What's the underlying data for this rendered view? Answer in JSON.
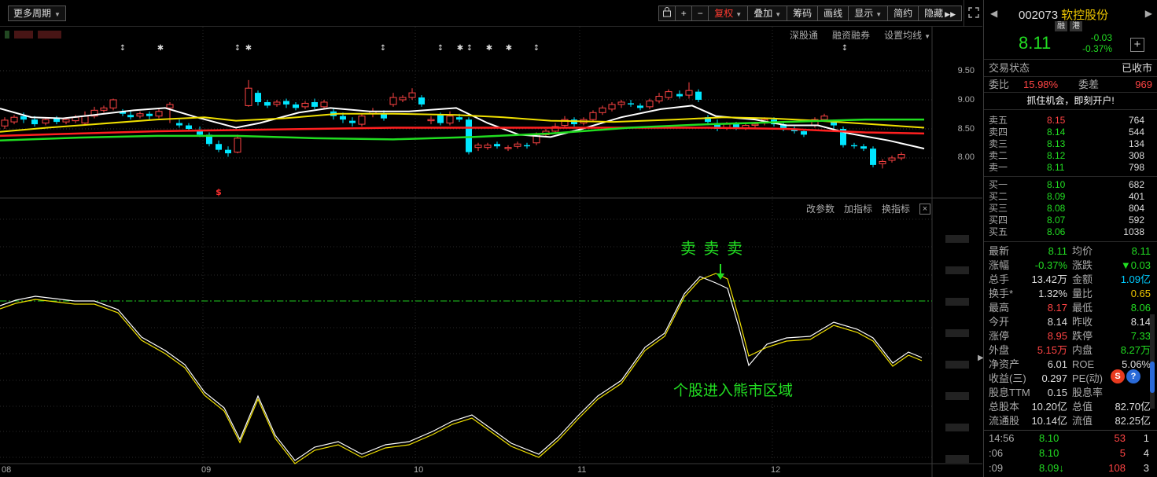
{
  "toolbar": {
    "period_label": "更多周期",
    "buttons": [
      "复权",
      "叠加",
      "筹码",
      "画线",
      "显示",
      "简约",
      "隐藏"
    ],
    "active_button": "复权"
  },
  "kline": {
    "links": [
      "深股通",
      "融资融券",
      "设置均线"
    ],
    "price_ticks": [
      "9.50",
      "9.00",
      "8.50",
      "8.00"
    ],
    "signal_marker": "$"
  },
  "indicator": {
    "links": [
      "改参数",
      "加指标",
      "换指标"
    ],
    "close_label": "×",
    "sell_label": "卖 卖 卖",
    "zone_label": "个股进入熊市区域"
  },
  "xaxis": {
    "labels": [
      "08",
      "09",
      "10",
      "11",
      "12"
    ]
  },
  "stock": {
    "code": "002073",
    "name": "软控股份",
    "tags": [
      "融",
      "港"
    ],
    "price": "8.11",
    "change": "-0.03",
    "change_pct": "-0.37%",
    "status_label": "交易状态",
    "status_value": "已收市",
    "ratio_label": "委比",
    "ratio_value": "15.98%",
    "diff_label": "委差",
    "diff_value": "969",
    "promo": "抓住机会，即刻开户!"
  },
  "orderbook": {
    "asks": [
      {
        "label": "卖五",
        "price": "8.15",
        "vol": "764",
        "up": true
      },
      {
        "label": "卖四",
        "price": "8.14",
        "vol": "544",
        "up": false
      },
      {
        "label": "卖三",
        "price": "8.13",
        "vol": "134",
        "up": false
      },
      {
        "label": "卖二",
        "price": "8.12",
        "vol": "308",
        "up": false
      },
      {
        "label": "卖一",
        "price": "8.11",
        "vol": "798",
        "up": false
      }
    ],
    "bids": [
      {
        "label": "买一",
        "price": "8.10",
        "vol": "682"
      },
      {
        "label": "买二",
        "price": "8.09",
        "vol": "401"
      },
      {
        "label": "买三",
        "price": "8.08",
        "vol": "804"
      },
      {
        "label": "买四",
        "price": "8.07",
        "vol": "592"
      },
      {
        "label": "买五",
        "price": "8.06",
        "vol": "1038"
      }
    ]
  },
  "quote": [
    {
      "k1": "最新",
      "v1": "8.11",
      "c1": "green",
      "k2": "均价",
      "v2": "8.11",
      "c2": "green"
    },
    {
      "k1": "涨幅",
      "v1": "-0.37%",
      "c1": "green",
      "k2": "涨跌",
      "v2": "▼0.03",
      "c2": "green"
    },
    {
      "k1": "总手",
      "v1": "13.42万",
      "c1": "",
      "k2": "金额",
      "v2": "1.09亿",
      "c2": "cyan"
    },
    {
      "k1": "换手*",
      "v1": "1.32%",
      "c1": "",
      "k2": "量比",
      "v2": "0.65",
      "c2": "yellow"
    },
    {
      "k1": "最高",
      "v1": "8.17",
      "c1": "red",
      "k2": "最低",
      "v2": "8.06",
      "c2": "green"
    },
    {
      "k1": "今开",
      "v1": "8.14",
      "c1": "",
      "k2": "昨收",
      "v2": "8.14",
      "c2": ""
    },
    {
      "k1": "涨停",
      "v1": "8.95",
      "c1": "red",
      "k2": "跌停",
      "v2": "7.33",
      "c2": "green"
    },
    {
      "k1": "外盘",
      "v1": "5.15万",
      "c1": "red",
      "k2": "内盘",
      "v2": "8.27万",
      "c2": "green"
    },
    {
      "k1": "净资产",
      "v1": "6.01",
      "c1": "",
      "k2": "ROE",
      "v2": "5.06%",
      "c2": ""
    },
    {
      "k1": "收益(三)",
      "v1": "0.297",
      "c1": "",
      "k2": "PE(动)",
      "v2": "",
      "c2": ""
    },
    {
      "k1": "股息TTM",
      "v1": "0.15",
      "c1": "",
      "k2": "股息率",
      "v2": "",
      "c2": ""
    },
    {
      "k1": "总股本",
      "v1": "10.20亿",
      "c1": "",
      "k2": "总值",
      "v2": "82.70亿",
      "c2": ""
    },
    {
      "k1": "流通股",
      "v1": "10.14亿",
      "c1": "",
      "k2": "流值",
      "v2": "82.25亿",
      "c2": ""
    }
  ],
  "ticks": [
    {
      "time": "14:56",
      "price": "8.10",
      "vol": "53",
      "count": "1",
      "arrow": ""
    },
    {
      "time": ":06",
      "price": "8.10",
      "vol": "5",
      "count": "4",
      "arrow": ""
    },
    {
      "time": ":09",
      "price": "8.09",
      "vol": "108",
      "count": "3",
      "arrow": "↓"
    }
  ],
  "colors": {
    "up": "#ff4444",
    "down": "#22dd22",
    "accent": "#f0c800",
    "ma_white": "#ffffff",
    "ma_yellow": "#f0e000",
    "ma_red": "#ff2020",
    "ma_green": "#20dd20"
  }
}
